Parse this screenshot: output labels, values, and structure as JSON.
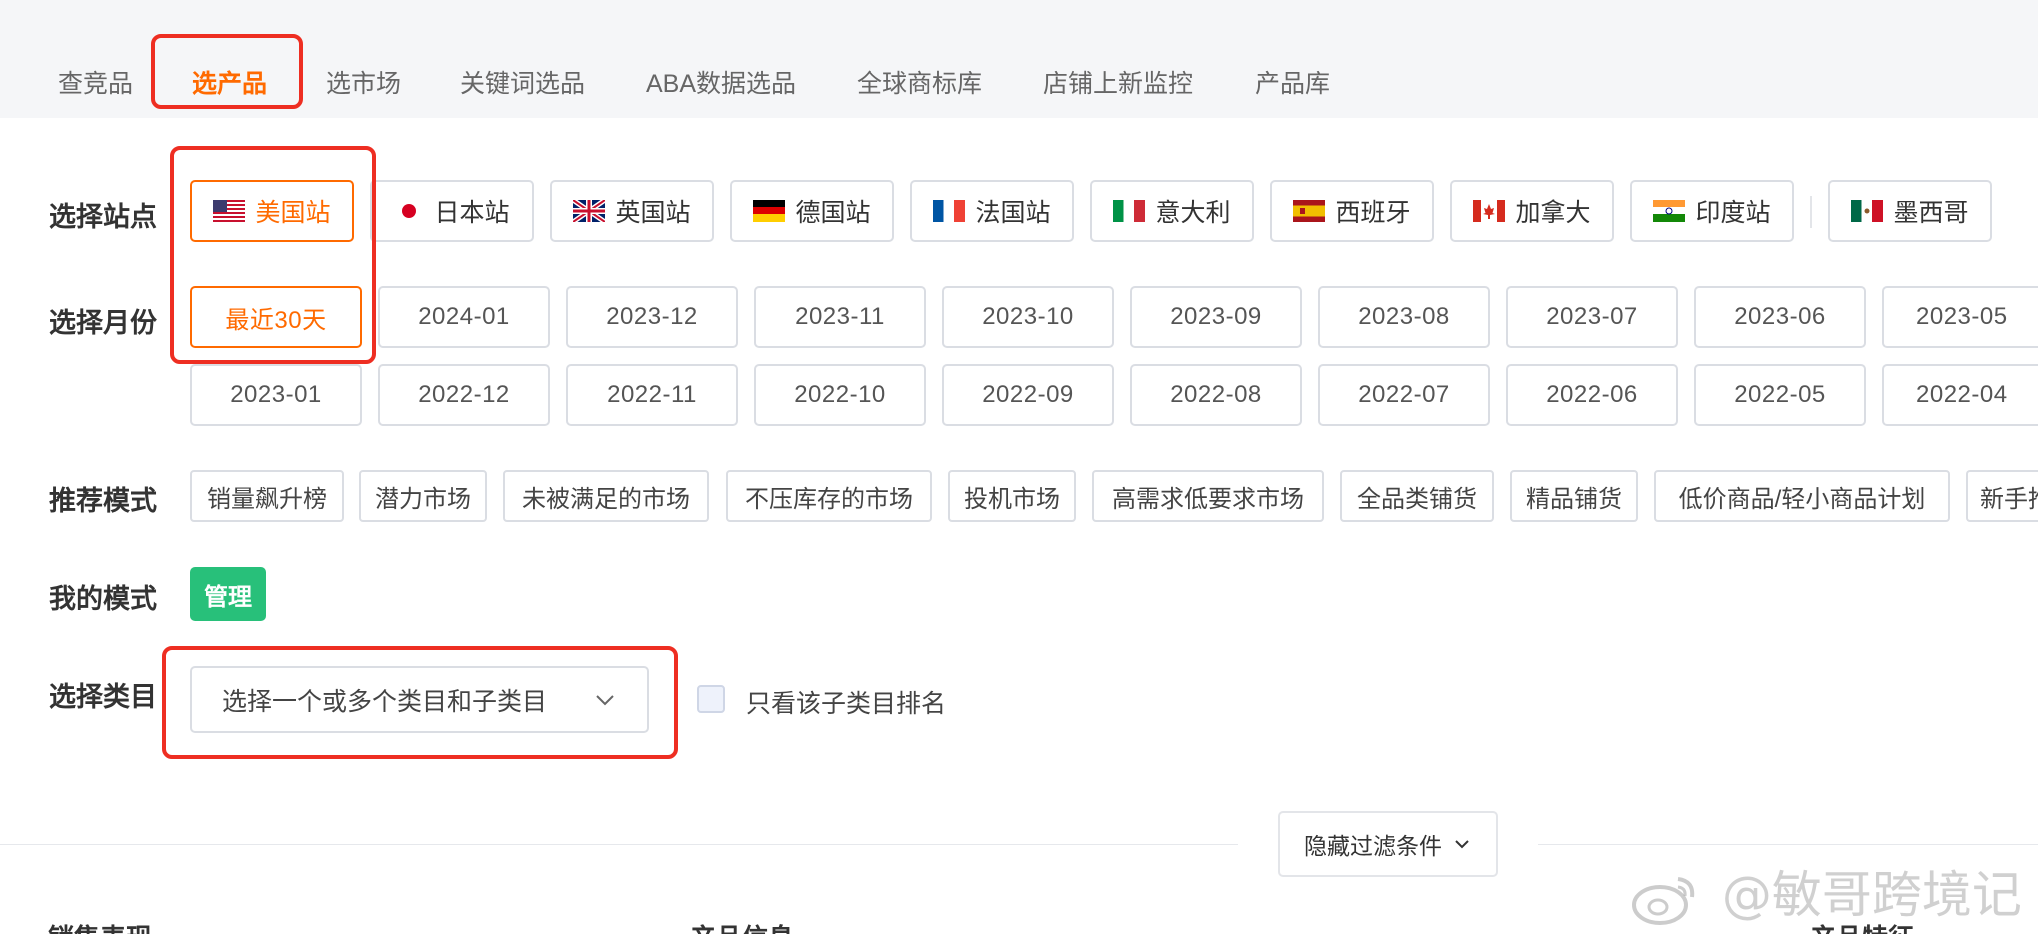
{
  "tabs": [
    {
      "label": "查竞品",
      "active": false
    },
    {
      "label": "选产品",
      "active": true
    },
    {
      "label": "选市场",
      "active": false
    },
    {
      "label": "关键词选品",
      "active": false
    },
    {
      "label": "ABA数据选品",
      "active": false
    },
    {
      "label": "全球商标库",
      "active": false
    },
    {
      "label": "店铺上新监控",
      "active": false
    },
    {
      "label": "产品库",
      "active": false
    }
  ],
  "filters": {
    "site_label": "选择站点",
    "sites": [
      {
        "label": "美国站",
        "flag": "us-flag-icon",
        "active": true
      },
      {
        "label": "日本站",
        "flag": "jp-flag-icon",
        "active": false
      },
      {
        "label": "英国站",
        "flag": "uk-flag-icon",
        "active": false
      },
      {
        "label": "德国站",
        "flag": "de-flag-icon",
        "active": false
      },
      {
        "label": "法国站",
        "flag": "fr-flag-icon",
        "active": false
      },
      {
        "label": "意大利",
        "flag": "it-flag-icon",
        "active": false
      },
      {
        "label": "西班牙",
        "flag": "es-flag-icon",
        "active": false
      },
      {
        "label": "加拿大",
        "flag": "ca-flag-icon",
        "active": false
      },
      {
        "label": "印度站",
        "flag": "in-flag-icon",
        "active": false
      },
      {
        "label": "墨西哥",
        "flag": "mx-flag-icon",
        "active": false
      }
    ],
    "month_label": "选择月份",
    "months_row1": [
      "最近30天",
      "2024-01",
      "2023-12",
      "2023-11",
      "2023-10",
      "2023-09",
      "2023-08",
      "2023-07",
      "2023-06",
      "2023-05"
    ],
    "months_row2": [
      "2023-01",
      "2022-12",
      "2022-11",
      "2022-10",
      "2022-09",
      "2022-08",
      "2022-07",
      "2022-06",
      "2022-05",
      "2022-04"
    ],
    "recommend_label": "推荐模式",
    "modes": [
      "销量飙升榜",
      "潜力市场",
      "未被满足的市场",
      "不压库存的市场",
      "投机市场",
      "高需求低要求市场",
      "全品类铺货",
      "精品铺货",
      "低价商品/轻小商品计划",
      "新手推"
    ],
    "my_mode_label": "我的模式",
    "manage_button": "管理",
    "category_label": "选择类目",
    "category_placeholder": "选择一个或多个类目和子类目",
    "only_sub_label": "只看该子类目排名",
    "hide_filters_button": "隐藏过滤条件"
  },
  "watermark": "@敏哥跨境记",
  "bottom_headers": [
    "销售表现",
    "产品信息",
    "产品特征"
  ],
  "colors": {
    "accent": "#ff6a00",
    "green": "#28c07a",
    "highlight": "#ee2e22"
  }
}
